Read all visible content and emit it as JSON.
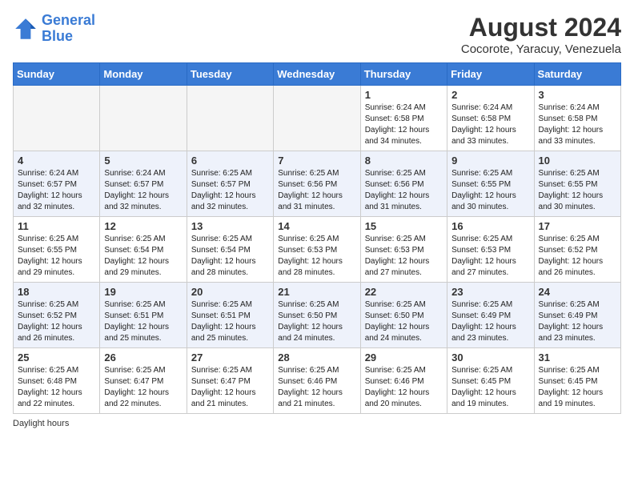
{
  "logo": {
    "line1": "General",
    "line2": "Blue"
  },
  "title": "August 2024",
  "subtitle": "Cocorote, Yaracuy, Venezuela",
  "days_header": [
    "Sunday",
    "Monday",
    "Tuesday",
    "Wednesday",
    "Thursday",
    "Friday",
    "Saturday"
  ],
  "footer": "Daylight hours",
  "weeks": [
    [
      {
        "day": "",
        "info": ""
      },
      {
        "day": "",
        "info": ""
      },
      {
        "day": "",
        "info": ""
      },
      {
        "day": "",
        "info": ""
      },
      {
        "day": "1",
        "info": "Sunrise: 6:24 AM\nSunset: 6:58 PM\nDaylight: 12 hours\nand 34 minutes."
      },
      {
        "day": "2",
        "info": "Sunrise: 6:24 AM\nSunset: 6:58 PM\nDaylight: 12 hours\nand 33 minutes."
      },
      {
        "day": "3",
        "info": "Sunrise: 6:24 AM\nSunset: 6:58 PM\nDaylight: 12 hours\nand 33 minutes."
      }
    ],
    [
      {
        "day": "4",
        "info": "Sunrise: 6:24 AM\nSunset: 6:57 PM\nDaylight: 12 hours\nand 32 minutes."
      },
      {
        "day": "5",
        "info": "Sunrise: 6:24 AM\nSunset: 6:57 PM\nDaylight: 12 hours\nand 32 minutes."
      },
      {
        "day": "6",
        "info": "Sunrise: 6:25 AM\nSunset: 6:57 PM\nDaylight: 12 hours\nand 32 minutes."
      },
      {
        "day": "7",
        "info": "Sunrise: 6:25 AM\nSunset: 6:56 PM\nDaylight: 12 hours\nand 31 minutes."
      },
      {
        "day": "8",
        "info": "Sunrise: 6:25 AM\nSunset: 6:56 PM\nDaylight: 12 hours\nand 31 minutes."
      },
      {
        "day": "9",
        "info": "Sunrise: 6:25 AM\nSunset: 6:55 PM\nDaylight: 12 hours\nand 30 minutes."
      },
      {
        "day": "10",
        "info": "Sunrise: 6:25 AM\nSunset: 6:55 PM\nDaylight: 12 hours\nand 30 minutes."
      }
    ],
    [
      {
        "day": "11",
        "info": "Sunrise: 6:25 AM\nSunset: 6:55 PM\nDaylight: 12 hours\nand 29 minutes."
      },
      {
        "day": "12",
        "info": "Sunrise: 6:25 AM\nSunset: 6:54 PM\nDaylight: 12 hours\nand 29 minutes."
      },
      {
        "day": "13",
        "info": "Sunrise: 6:25 AM\nSunset: 6:54 PM\nDaylight: 12 hours\nand 28 minutes."
      },
      {
        "day": "14",
        "info": "Sunrise: 6:25 AM\nSunset: 6:53 PM\nDaylight: 12 hours\nand 28 minutes."
      },
      {
        "day": "15",
        "info": "Sunrise: 6:25 AM\nSunset: 6:53 PM\nDaylight: 12 hours\nand 27 minutes."
      },
      {
        "day": "16",
        "info": "Sunrise: 6:25 AM\nSunset: 6:53 PM\nDaylight: 12 hours\nand 27 minutes."
      },
      {
        "day": "17",
        "info": "Sunrise: 6:25 AM\nSunset: 6:52 PM\nDaylight: 12 hours\nand 26 minutes."
      }
    ],
    [
      {
        "day": "18",
        "info": "Sunrise: 6:25 AM\nSunset: 6:52 PM\nDaylight: 12 hours\nand 26 minutes."
      },
      {
        "day": "19",
        "info": "Sunrise: 6:25 AM\nSunset: 6:51 PM\nDaylight: 12 hours\nand 25 minutes."
      },
      {
        "day": "20",
        "info": "Sunrise: 6:25 AM\nSunset: 6:51 PM\nDaylight: 12 hours\nand 25 minutes."
      },
      {
        "day": "21",
        "info": "Sunrise: 6:25 AM\nSunset: 6:50 PM\nDaylight: 12 hours\nand 24 minutes."
      },
      {
        "day": "22",
        "info": "Sunrise: 6:25 AM\nSunset: 6:50 PM\nDaylight: 12 hours\nand 24 minutes."
      },
      {
        "day": "23",
        "info": "Sunrise: 6:25 AM\nSunset: 6:49 PM\nDaylight: 12 hours\nand 23 minutes."
      },
      {
        "day": "24",
        "info": "Sunrise: 6:25 AM\nSunset: 6:49 PM\nDaylight: 12 hours\nand 23 minutes."
      }
    ],
    [
      {
        "day": "25",
        "info": "Sunrise: 6:25 AM\nSunset: 6:48 PM\nDaylight: 12 hours\nand 22 minutes."
      },
      {
        "day": "26",
        "info": "Sunrise: 6:25 AM\nSunset: 6:47 PM\nDaylight: 12 hours\nand 22 minutes."
      },
      {
        "day": "27",
        "info": "Sunrise: 6:25 AM\nSunset: 6:47 PM\nDaylight: 12 hours\nand 21 minutes."
      },
      {
        "day": "28",
        "info": "Sunrise: 6:25 AM\nSunset: 6:46 PM\nDaylight: 12 hours\nand 21 minutes."
      },
      {
        "day": "29",
        "info": "Sunrise: 6:25 AM\nSunset: 6:46 PM\nDaylight: 12 hours\nand 20 minutes."
      },
      {
        "day": "30",
        "info": "Sunrise: 6:25 AM\nSunset: 6:45 PM\nDaylight: 12 hours\nand 19 minutes."
      },
      {
        "day": "31",
        "info": "Sunrise: 6:25 AM\nSunset: 6:45 PM\nDaylight: 12 hours\nand 19 minutes."
      }
    ]
  ]
}
